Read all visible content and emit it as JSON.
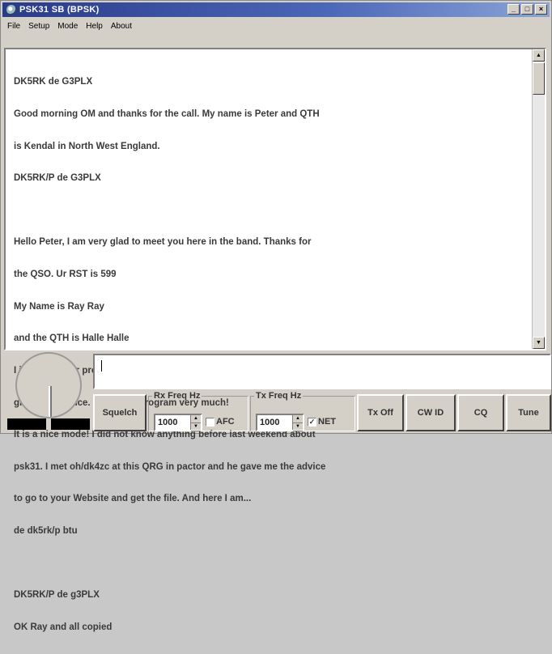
{
  "window": {
    "title": "PSK31 SB (BPSK)"
  },
  "menu": [
    "File",
    "Setup",
    "Mode",
    "Help",
    "About"
  ],
  "rx_text": [
    "DK5RK de G3PLX",
    "Good morning OM and thanks for the call. My name is Peter and QTH",
    "is Kendal in North West England.",
    "DK5RK/P de G3PLX",
    "",
    "Hello Peter, I am very glad to meet you here in the band. Thanks for",
    "the QSO. Ur RST is 599",
    "My Name is Ray Ray",
    "and the QTH is Halle Halle",
    "I installed your program and I was QRV after one hour! That was a",
    "great experience. I like your program very much!",
    "It is a nice mode! I did not know anything before last weekend about",
    "psk31. I met oh/dk4zc at this QRG in pactor and he gave me the advice",
    "to go to your Website and get the file. And here I am...",
    "de dk5rk/p btu",
    "",
    "DK5RK/P de g3PLX",
    "OK Ray and all copied"
  ],
  "controls": {
    "squelch": "Squelch",
    "rx_freq": {
      "legend": "Rx Freq Hz",
      "value": "1000",
      "checkbox_label": "AFC",
      "checked": false
    },
    "tx_freq": {
      "legend": "Tx Freq Hz",
      "value": "1000",
      "checkbox_label": "NET",
      "checked": true
    },
    "tx_off": "Tx Off",
    "cw_id": "CW ID",
    "cq": "CQ",
    "tune": "Tune"
  },
  "title_buttons": [
    "minimize-icon",
    "maximize-icon",
    "close-icon"
  ]
}
